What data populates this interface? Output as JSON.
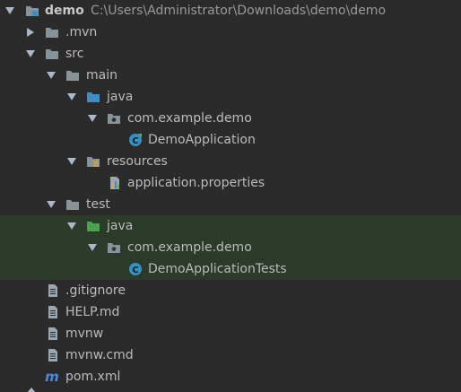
{
  "project": {
    "name": "demo",
    "path": "C:\\Users\\Administrator\\Downloads\\demo\\demo"
  },
  "colors": {
    "background": "#2b2b2b",
    "test_highlight": "#2c3a2c",
    "text": "#bbbbbb",
    "folder": "#87939a",
    "source_folder": "#3d8ec7",
    "test_folder": "#4aa54a",
    "class_icon": "#3592c4",
    "maven": "#4b89dc"
  },
  "tree": {
    "mvn": ".mvn",
    "src": "src",
    "main": "main",
    "main_java": "java",
    "main_package": "com.example.demo",
    "main_class": "DemoApplication",
    "resources": "resources",
    "properties": "application.properties",
    "test": "test",
    "test_java": "java",
    "test_package": "com.example.demo",
    "test_class": "DemoApplicationTests",
    "gitignore": ".gitignore",
    "help": "HELP.md",
    "mvnw": "mvnw",
    "mvnw_cmd": "mvnw.cmd",
    "pom": "pom.xml"
  },
  "icons": {
    "project": "module-folder-icon",
    "folder": "folder-icon",
    "source_root": "source-root-icon",
    "test_root": "test-root-icon",
    "package": "package-icon",
    "class": "class-icon",
    "resources": "resources-root-icon",
    "properties": "properties-file-icon",
    "text_file": "text-file-icon",
    "maven": "maven-icon"
  }
}
